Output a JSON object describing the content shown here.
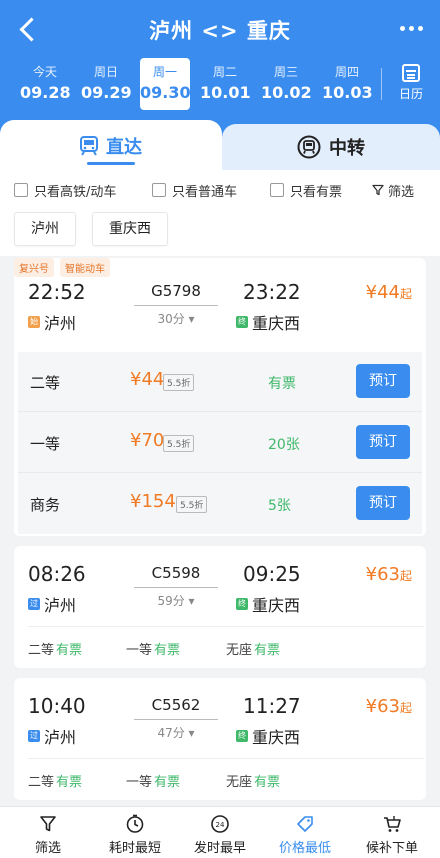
{
  "nav": {
    "title": "泸州 <> 重庆"
  },
  "dates": [
    {
      "weekday": "今天",
      "date": "09.28"
    },
    {
      "weekday": "周日",
      "date": "09.29"
    },
    {
      "weekday": "周一",
      "date": "09.30"
    },
    {
      "weekday": "周二",
      "date": "10.01"
    },
    {
      "weekday": "周三",
      "date": "10.02"
    },
    {
      "weekday": "周四",
      "date": "10.03"
    }
  ],
  "calendar_label": "日历",
  "tabs": {
    "direct": "直达",
    "transfer": "中转"
  },
  "filters": {
    "high_speed": "只看高铁/动车",
    "normal": "只看普通车",
    "available": "只看有票",
    "filter": "筛选",
    "from_station": "泸州",
    "to_station": "重庆西"
  },
  "trains": [
    {
      "badges": [
        "复兴号",
        "智能动车"
      ],
      "depart_time": "22:52",
      "train_no": "G5798",
      "arrive_time": "23:22",
      "from": "泸州",
      "from_tag": "始",
      "to": "重庆西",
      "to_tag": "终",
      "duration": "30分",
      "price_symbol": "¥",
      "price": "44",
      "price_suffix": "起",
      "seats": [
        {
          "name": "二等",
          "price": "¥44",
          "discount": "5.5折",
          "avail": "有票",
          "book": "预订"
        },
        {
          "name": "一等",
          "price": "¥70",
          "discount": "5.5折",
          "avail": "20张",
          "book": "预订"
        },
        {
          "name": "商务",
          "price": "¥154",
          "discount": "5.5折",
          "avail": "5张",
          "book": "预订"
        }
      ]
    },
    {
      "depart_time": "08:26",
      "train_no": "C5598",
      "arrive_time": "09:25",
      "from": "泸州",
      "from_tag": "过",
      "to": "重庆西",
      "to_tag": "终",
      "duration": "59分",
      "price_symbol": "¥",
      "price": "63",
      "price_suffix": "起",
      "seats": [
        {
          "name": "二等",
          "avail": "有票"
        },
        {
          "name": "一等",
          "avail": "有票"
        },
        {
          "name": "无座",
          "avail": "有票"
        }
      ]
    },
    {
      "depart_time": "10:40",
      "train_no": "C5562",
      "arrive_time": "11:27",
      "from": "泸州",
      "from_tag": "过",
      "to": "重庆西",
      "to_tag": "终",
      "duration": "47分",
      "price_symbol": "¥",
      "price": "63",
      "price_suffix": "起",
      "seats": [
        {
          "name": "二等",
          "avail": "有票"
        },
        {
          "name": "一等",
          "avail": "有票"
        },
        {
          "name": "无座",
          "avail": "有票"
        }
      ]
    }
  ],
  "bottom_bar": [
    {
      "label": "筛选"
    },
    {
      "label": "耗时最短"
    },
    {
      "label": "发时最早"
    },
    {
      "label": "价格最低"
    },
    {
      "label": "候补下单"
    }
  ],
  "colors": {
    "primary": "#3a8dee",
    "price": "#f07b24",
    "available": "#3fb86a"
  }
}
